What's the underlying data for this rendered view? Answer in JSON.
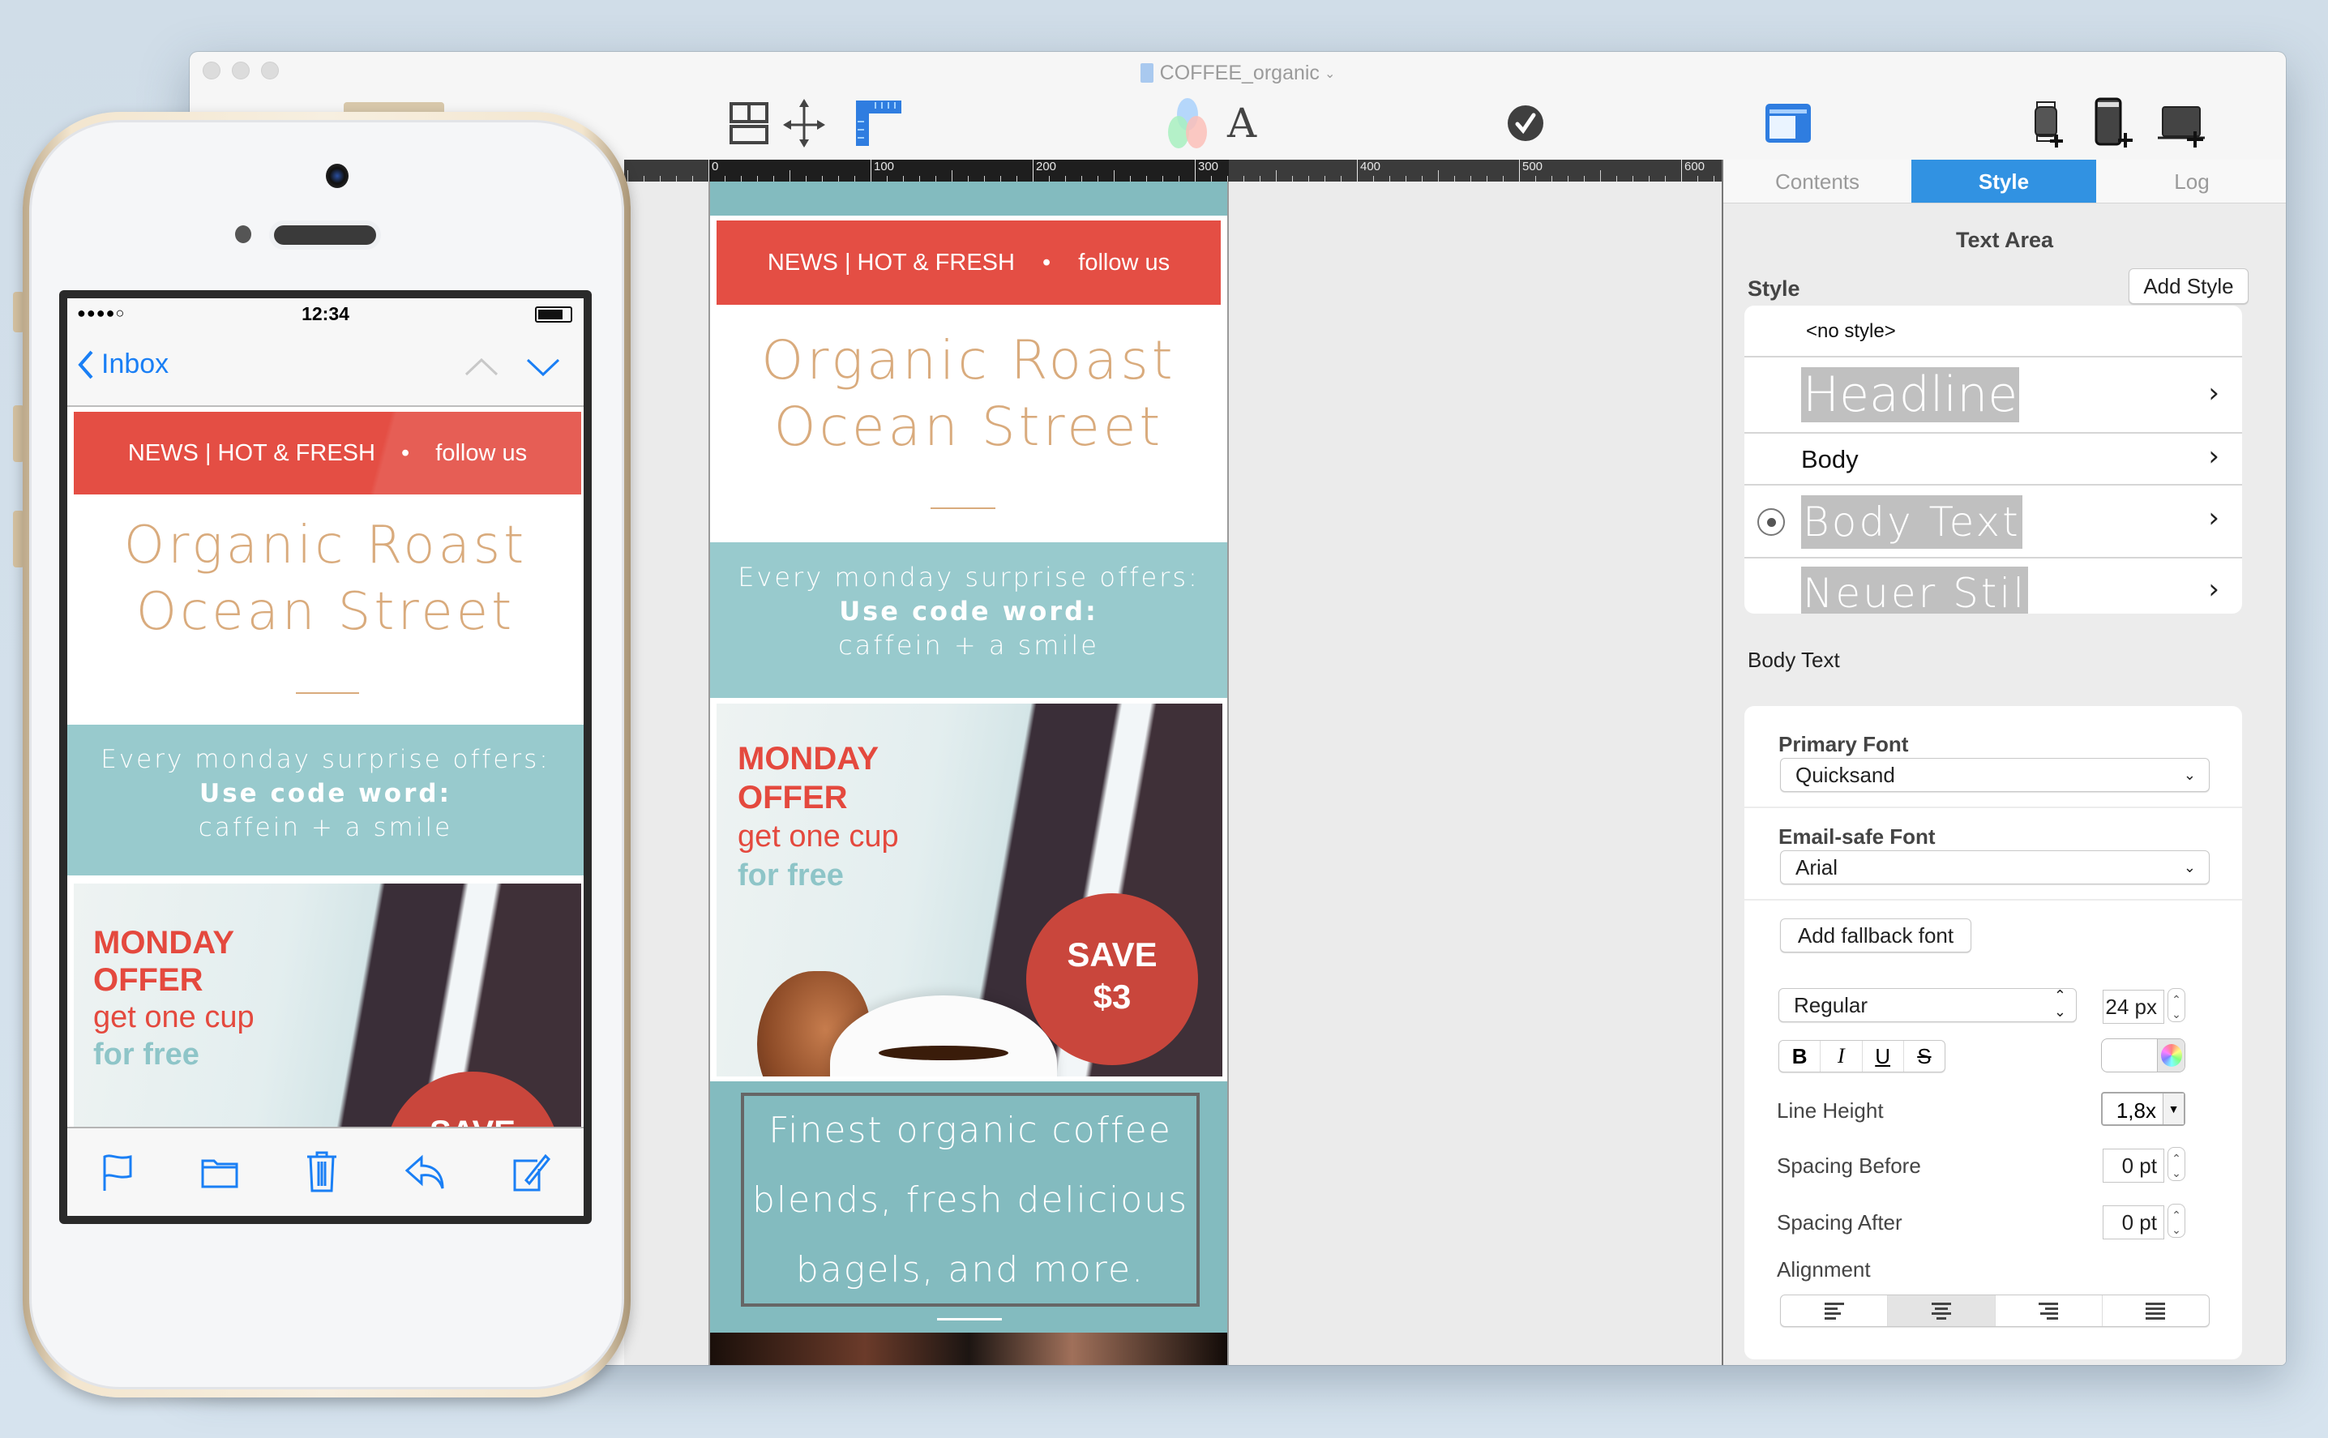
{
  "window": {
    "title": "COFFEE_organic",
    "toolbar": {
      "icons": [
        "layout-icon",
        "move-icon",
        "ruler-icon",
        "color-mixer-icon",
        "font-icon",
        "checkmark-icon",
        "sidebar-toggle-icon",
        "add-watch-preview-icon",
        "add-phone-preview-icon",
        "add-laptop-preview-icon"
      ]
    }
  },
  "ruler": {
    "labels": [
      "0",
      "100",
      "200",
      "300",
      "400",
      "500",
      "600"
    ]
  },
  "email": {
    "topbar": {
      "news": "NEWS | HOT & FRESH",
      "bullet": "•",
      "follow": "follow us"
    },
    "heading": {
      "line1": "Organic Roast",
      "line2": "Ocean Street"
    },
    "promo": {
      "line1": "Every monday surprise offers:",
      "line2": "Use code word:",
      "line3": "caffein + a smile"
    },
    "hero": {
      "line1": "MONDAY",
      "line2": "OFFER",
      "line3": "get one cup",
      "line4": "for free",
      "badge_line1": "SAVE",
      "badge_line2": "$3"
    },
    "tagline": {
      "line1": "Finest organic coffee",
      "line2": "blends, fresh delicious",
      "line3": "bagels, and more."
    },
    "colors": {
      "red": "#e44e44",
      "teal": "#83bbbf",
      "light_teal": "#98cacd",
      "tan": "#d9ab7d"
    }
  },
  "sidebar": {
    "tabs": [
      {
        "label": "Contents",
        "active": false
      },
      {
        "label": "Style",
        "active": true
      },
      {
        "label": "Log",
        "active": false
      }
    ],
    "section_title": "Text Area",
    "style_label": "Style",
    "add_style": "Add Style",
    "styles": [
      {
        "label": "<no style>",
        "selected": false
      },
      {
        "label": "Headline",
        "selected": false
      },
      {
        "label": "Body",
        "selected": false
      },
      {
        "label": "Body Text",
        "selected": true
      },
      {
        "label": "Neuer Stil",
        "selected": false
      }
    ],
    "current_style": "Body Text",
    "primary_font_label": "Primary Font",
    "primary_font": "Quicksand",
    "email_safe_font_label": "Email-safe Font",
    "email_safe_font": "Arial",
    "add_fallback": "Add fallback font",
    "weight": "Regular",
    "size": "24 px",
    "format_buttons": [
      "B",
      "I",
      "U",
      "S"
    ],
    "line_height_label": "Line Height",
    "line_height": "1,8x",
    "spacing_before_label": "Spacing Before",
    "spacing_before": "0 pt",
    "spacing_after_label": "Spacing After",
    "spacing_after": "0 pt",
    "alignment_label": "Alignment",
    "alignment": [
      "left",
      "center",
      "right",
      "justify"
    ],
    "alignment_selected": "center"
  },
  "phone": {
    "status": {
      "signal": "●●●●○",
      "time": "12:34"
    },
    "nav": {
      "back_label": "Inbox"
    },
    "toolbar_icons": [
      "flag-icon",
      "folder-icon",
      "trash-icon",
      "reply-icon",
      "compose-icon"
    ]
  }
}
